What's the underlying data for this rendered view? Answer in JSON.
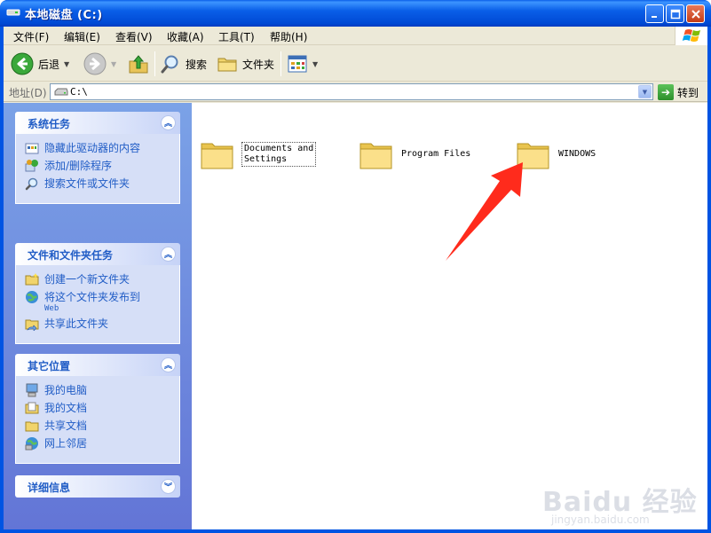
{
  "window": {
    "title": "本地磁盘 (C:)"
  },
  "menu": [
    "文件(F)",
    "编辑(E)",
    "查看(V)",
    "收藏(A)",
    "工具(T)",
    "帮助(H)"
  ],
  "toolbar": {
    "back": "后退",
    "search": "搜索",
    "folders": "文件夹"
  },
  "address": {
    "label": "地址(D)",
    "value": "C:\\",
    "go": "转到"
  },
  "panels": {
    "system": {
      "title": "系统任务",
      "items": [
        "隐藏此驱动器的内容",
        "添加/删除程序",
        "搜索文件或文件夹"
      ]
    },
    "file": {
      "title": "文件和文件夹任务",
      "items": [
        "创建一个新文件夹",
        "将这个文件夹发布到",
        "共享此文件夹"
      ],
      "publish_sub": "Web"
    },
    "other": {
      "title": "其它位置",
      "items": [
        "我的电脑",
        "我的文档",
        "共享文档",
        "网上邻居"
      ]
    },
    "details": {
      "title": "详细信息"
    }
  },
  "folders": [
    {
      "line1": "Documents and",
      "line2": "Settings"
    },
    {
      "line1": "Program Files"
    },
    {
      "line1": "WINDOWS"
    }
  ],
  "watermark": {
    "main": "Baidu 经验",
    "sub": "jingyan.baidu.com"
  },
  "colors": {
    "title_blue": "#0054e3",
    "panel_text": "#215dc6",
    "sidebar_bg": "#7ba2e7",
    "arrow": "#ff2b1c",
    "folder": "#f5d768"
  }
}
